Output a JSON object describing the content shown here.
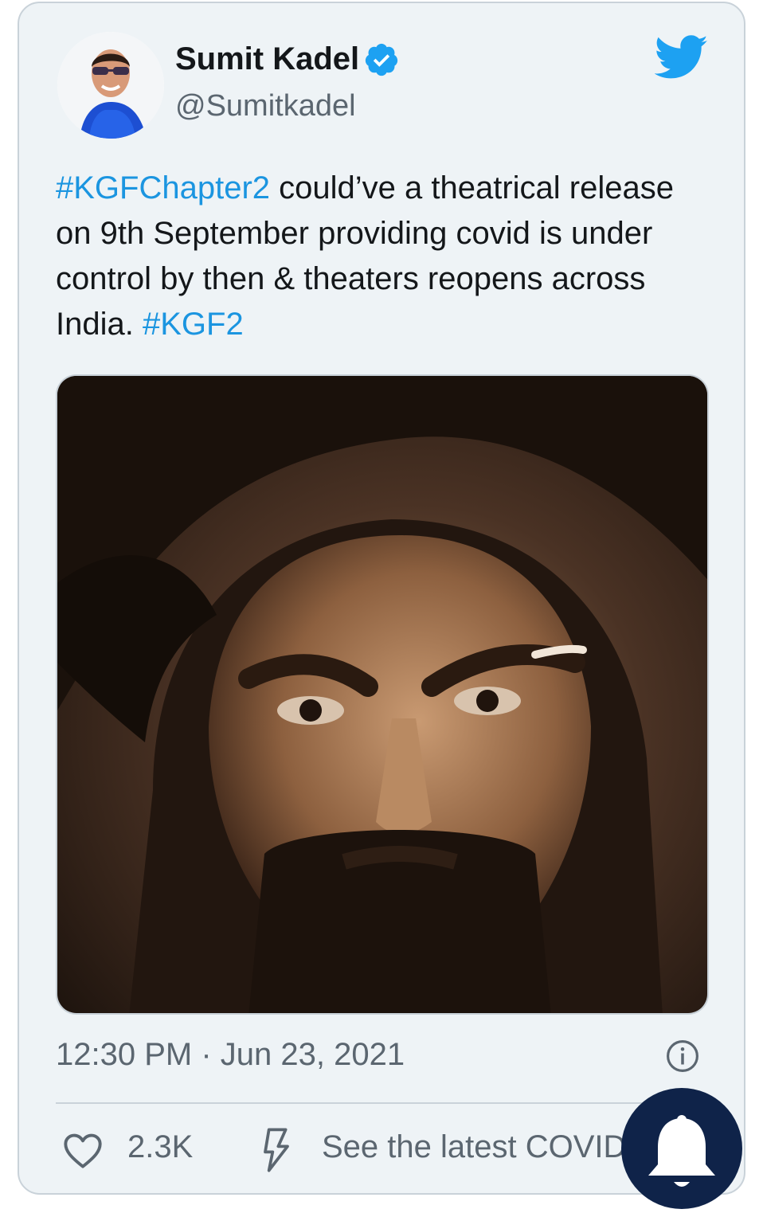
{
  "tweet": {
    "author_name": "Sumit Kadel",
    "author_handle": "@Sumitkadel",
    "text_parts": [
      "#KGFChapter2",
      " could’ve a theatrical release on 9th September providing covid is under control by then & theaters reopens across India.  ",
      "#KGF2"
    ],
    "timestamp": "12:30 PM · Jun 23, 2021",
    "likes": "2.3K",
    "covid_link": "See the latest COVID"
  },
  "icons": {
    "verified": "verified-badge-icon",
    "brand": "twitter-bird-icon",
    "info": "info-icon",
    "like": "heart-icon",
    "covid": "lightning-icon",
    "notification": "bell-icon"
  },
  "colors": {
    "link": "#1b95e0",
    "text": "#14171a",
    "muted": "#5b6670",
    "card_bg": "#eef3f6",
    "bell_bg": "#0f2349"
  }
}
